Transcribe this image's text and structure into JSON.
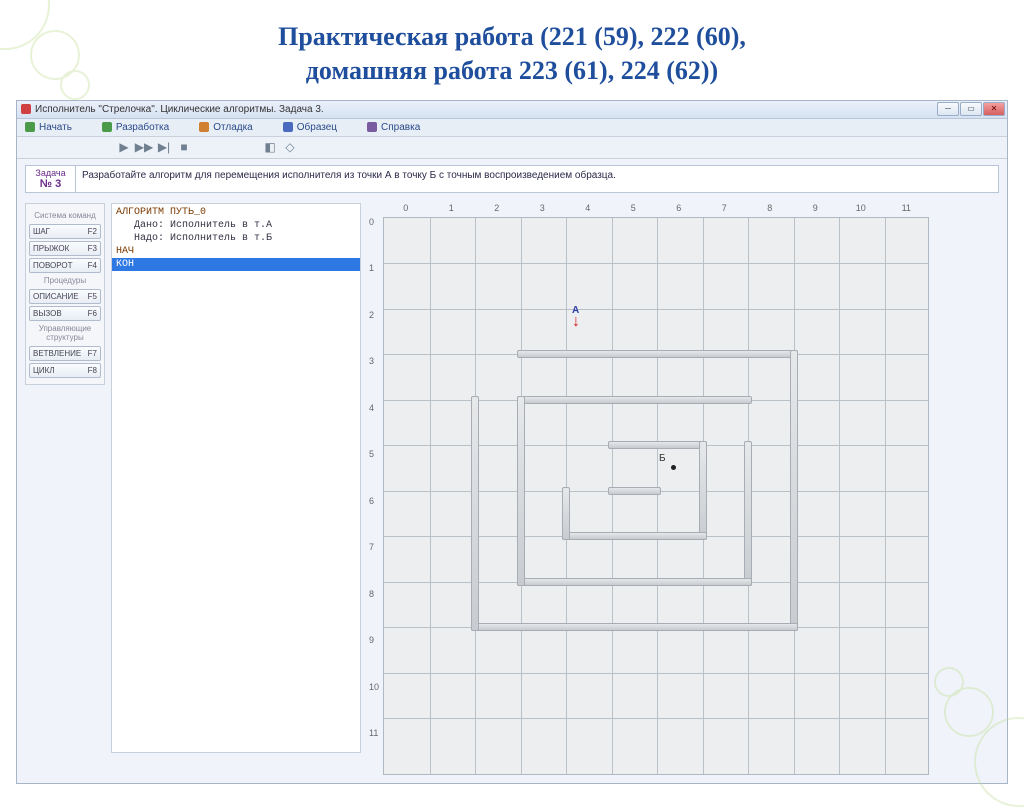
{
  "slide": {
    "title_line1": "Практическая работа (221 (59), 222 (60),",
    "title_line2": "домашняя работа 223 (61), 224 (62))"
  },
  "window": {
    "title": "Исполнитель \"Стрелочка\". Циклические алгоритмы. Задача 3."
  },
  "menu": {
    "start": "Начать",
    "develop": "Разработка",
    "debug": "Отладка",
    "sample": "Образец",
    "help": "Справка"
  },
  "task": {
    "label": "Задача",
    "number": "№ 3",
    "text": "Разработайте алгоритм для перемещения исполнителя из точки А в точку Б с точным воспроизведением образца."
  },
  "commands": {
    "section1": "Система команд",
    "items1": [
      {
        "name": "ШАГ",
        "key": "F2"
      },
      {
        "name": "ПРЫЖОК",
        "key": "F3"
      },
      {
        "name": "ПОВОРОТ",
        "key": "F4"
      }
    ],
    "section2": "Процедуры",
    "items2": [
      {
        "name": "ОПИСАНИЕ",
        "key": "F5"
      },
      {
        "name": "ВЫЗОВ",
        "key": "F6"
      }
    ],
    "section3": "Управляющие структуры",
    "items3": [
      {
        "name": "ВЕТВЛЕНИЕ",
        "key": "F7"
      },
      {
        "name": "ЦИКЛ",
        "key": "F8"
      }
    ]
  },
  "code": {
    "l1": "АЛГОРИТМ ПУТЬ_0",
    "l2": "   Дано: Исполнитель в т.А",
    "l3": "   Надо: Исполнитель в т.Б",
    "l4": "НАЧ",
    "l5": "КОН"
  },
  "grid": {
    "cols": 12,
    "rows": 12,
    "pointA": {
      "label": "А",
      "col": 4,
      "row": 2
    },
    "pointB": {
      "label": "Б",
      "col": 6,
      "row": 5
    }
  }
}
